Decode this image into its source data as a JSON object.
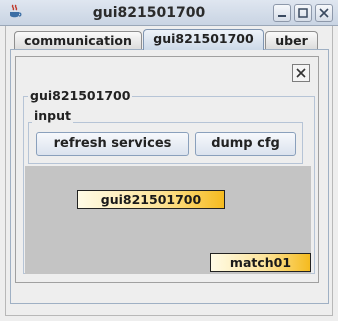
{
  "window": {
    "title": "gui821501700",
    "icons": {
      "app": "java-cup-icon",
      "minimize": "minimize-icon",
      "maximize": "maximize-icon",
      "close": "close-icon"
    }
  },
  "tabs": [
    {
      "label": "communication",
      "selected": false
    },
    {
      "label": "gui821501700",
      "selected": true
    },
    {
      "label": "uber",
      "selected": false
    }
  ],
  "panel": {
    "close_icon": "close-icon",
    "group_title": "gui821501700",
    "input_group": {
      "title": "input",
      "buttons": {
        "refresh_label": "refresh services",
        "dump_label": "dump cfg"
      }
    }
  },
  "canvas": {
    "background": "#c4c4c4",
    "nodes": [
      {
        "label": "gui821501700"
      },
      {
        "label": "match01"
      }
    ],
    "node_gradient": [
      "#fffbe6",
      "#f5bb1f"
    ]
  }
}
